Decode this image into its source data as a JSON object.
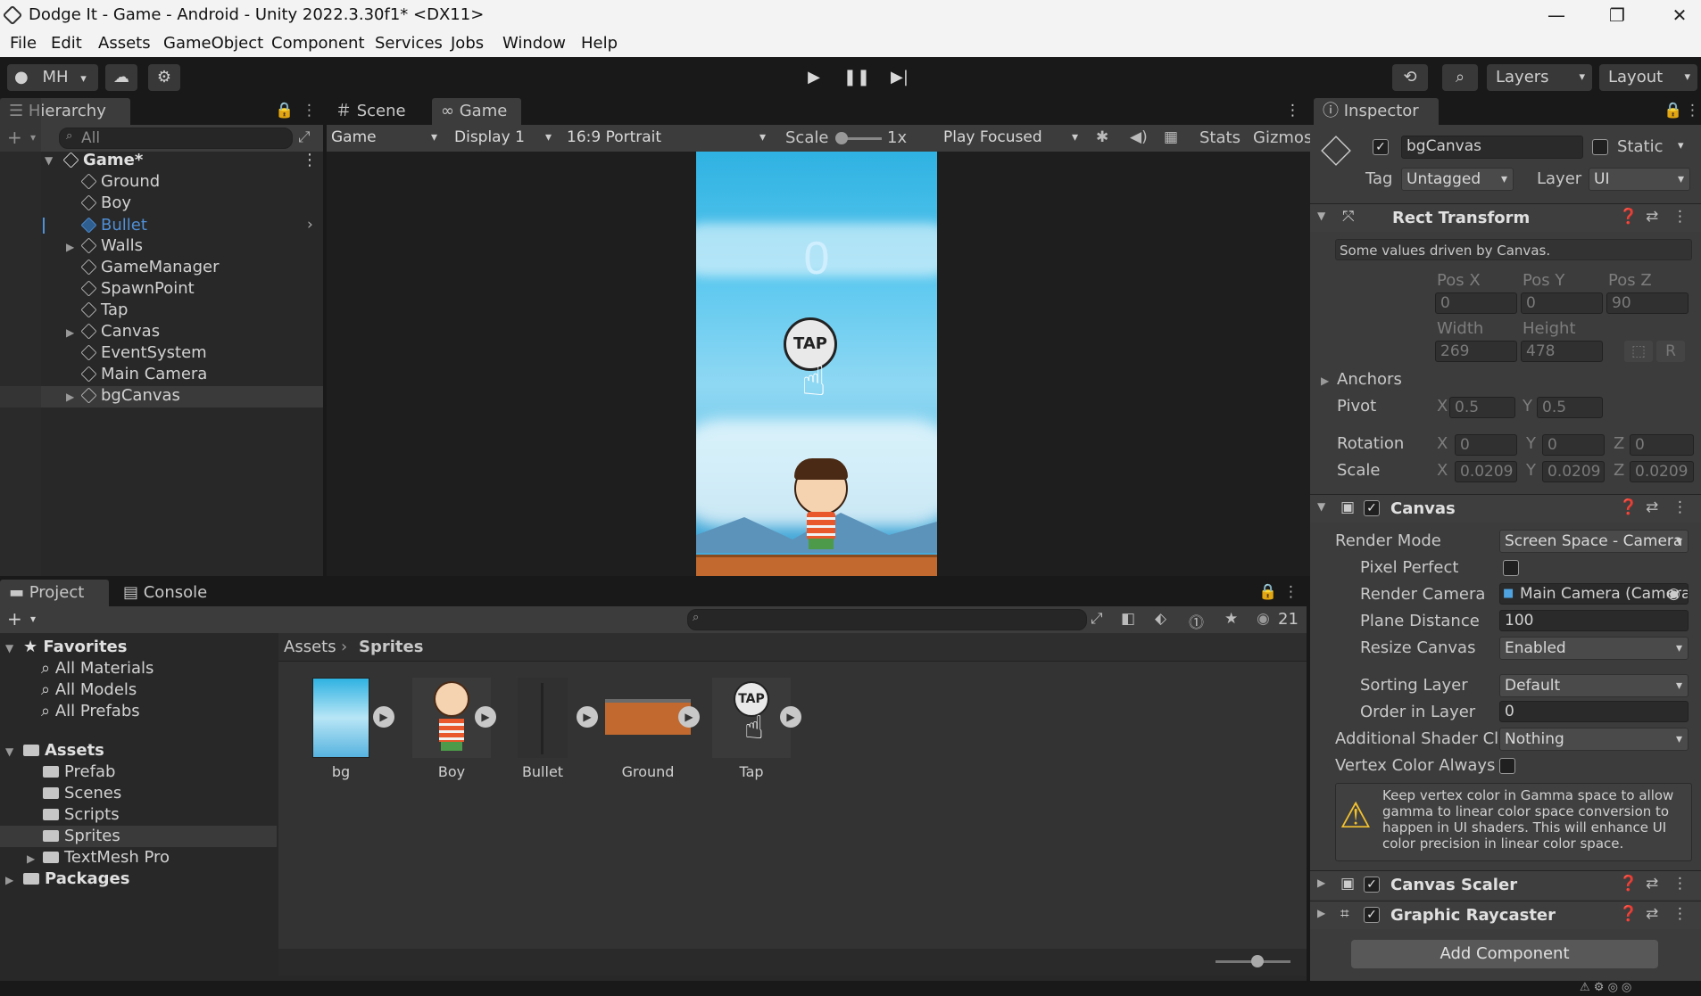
{
  "window": {
    "title": "Dodge It - Game - Android - Unity 2022.3.30f1* <DX11>"
  },
  "menu": [
    "File",
    "Edit",
    "Assets",
    "GameObject",
    "Component",
    "Services",
    "Jobs",
    "Window",
    "Help"
  ],
  "toolbar": {
    "account": "MH",
    "layers": "Layers",
    "layout": "Layout"
  },
  "hierarchy": {
    "tab": "Hierarchy",
    "search_placeholder": "All",
    "scene": "Game*",
    "items": [
      "Ground",
      "Boy",
      "Bullet",
      "Walls",
      "GameManager",
      "SpawnPoint",
      "Tap",
      "Canvas",
      "EventSystem",
      "Main Camera",
      "bgCanvas"
    ]
  },
  "game_view": {
    "tabs": [
      "Scene",
      "Game"
    ],
    "mode": "Game",
    "display": "Display 1",
    "aspect": "16:9 Portrait",
    "scale_label": "Scale",
    "scale_value": "1x",
    "play_mode": "Play Focused",
    "stats": "Stats",
    "gizmos": "Gizmos",
    "score": "0",
    "tap_text": "TAP"
  },
  "project": {
    "tabs": [
      "Project",
      "Console"
    ],
    "count": "21",
    "favorites": {
      "title": "Favorites",
      "items": [
        "All Materials",
        "All Models",
        "All Prefabs"
      ]
    },
    "assets": {
      "title": "Assets",
      "items": [
        "Prefab",
        "Scenes",
        "Scripts",
        "Sprites",
        "TextMesh Pro"
      ]
    },
    "packages": "Packages",
    "breadcrumb": [
      "Assets",
      "Sprites"
    ],
    "sprites": [
      "bg",
      "Boy",
      "Bullet",
      "Ground",
      "Tap"
    ]
  },
  "inspector": {
    "tab": "Inspector",
    "object_name": "bgCanvas",
    "static_label": "Static",
    "tag_label": "Tag",
    "tag": "Untagged",
    "layer_label": "Layer",
    "layer": "UI",
    "rect_transform": {
      "title": "Rect Transform",
      "note": "Some values driven by Canvas.",
      "pos_labels": [
        "Pos X",
        "Pos Y",
        "Pos Z"
      ],
      "pos": [
        "0",
        "0",
        "90"
      ],
      "size_labels": [
        "Width",
        "Height"
      ],
      "size": [
        "269",
        "478"
      ],
      "anchors": "Anchors",
      "pivot_label": "Pivot",
      "pivot": [
        "0.5",
        "0.5"
      ],
      "rotation_label": "Rotation",
      "rotation": [
        "0",
        "0",
        "0"
      ],
      "scale_label": "Scale",
      "scale": [
        "0.0209",
        "0.0209",
        "0.0209"
      ],
      "axis": [
        "X",
        "Y",
        "Z"
      ],
      "raw_btn": "R"
    },
    "canvas": {
      "title": "Canvas",
      "render_mode_label": "Render Mode",
      "render_mode": "Screen Space - Camera",
      "pixel_perfect_label": "Pixel Perfect",
      "render_camera_label": "Render Camera",
      "render_camera": "Main Camera (Camera)",
      "plane_distance_label": "Plane Distance",
      "plane_distance": "100",
      "resize_canvas_label": "Resize Canvas",
      "resize_canvas": "Enabled",
      "sorting_layer_label": "Sorting Layer",
      "sorting_layer": "Default",
      "order_label": "Order in Layer",
      "order": "0",
      "shader_label": "Additional Shader Cl",
      "shader": "Nothing",
      "vertex_label": "Vertex Color Always",
      "warning": "Keep vertex color in Gamma space to allow gamma to linear color space conversion to happen in UI shaders. This will enhance UI color precision in linear color space."
    },
    "canvas_scaler": "Canvas Scaler",
    "graphic_raycaster": "Graphic Raycaster",
    "add_component": "Add Component"
  },
  "colors": {
    "selected_text": "#4f8fd6",
    "accent_check": "#e8e8e8",
    "sky": "#3fb9e3"
  }
}
